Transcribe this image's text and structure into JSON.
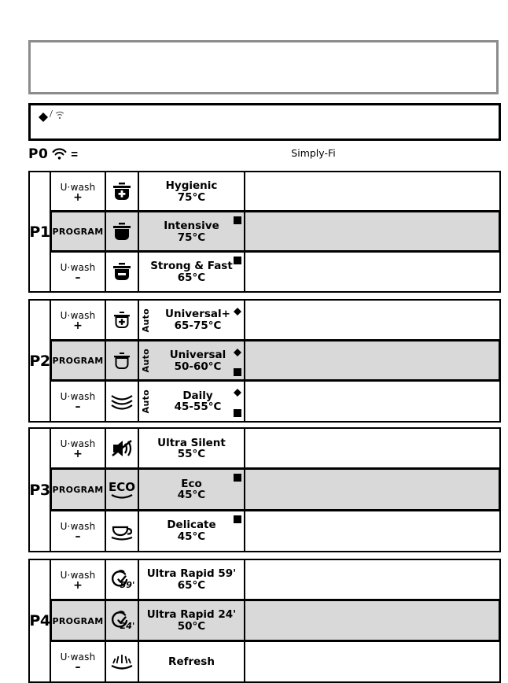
{
  "top_box": {
    "content": ""
  },
  "legend_box": {
    "diamond_icon": "diamond-marker",
    "separator": "/",
    "wifi_icon": "wifi-icon-faint"
  },
  "p0": {
    "label": "P0",
    "wifi_icon": "wifi-icon",
    "equals": "=",
    "brand": "Simply-Fi"
  },
  "wash_labels": {
    "plus_line1": "U·wash",
    "plus_line2": "+",
    "program": "PROGRAM",
    "minus_line1": "U·wash",
    "minus_line2": "–"
  },
  "auto_label": "Auto",
  "groups": [
    {
      "id": "P1",
      "label": "P1",
      "rows": [
        {
          "wash": "plus",
          "icon": "pot-plus-filled-icon",
          "auto": false,
          "title": "Hygienic",
          "temp": "75°C",
          "diamond": false,
          "square": false,
          "selected": false,
          "description": ""
        },
        {
          "wash": "program",
          "icon": "pot-filled-icon",
          "auto": false,
          "title": "Intensive",
          "temp": "75°C",
          "diamond": false,
          "square": true,
          "selected": true,
          "description": ""
        },
        {
          "wash": "minus",
          "icon": "pot-minus-filled-icon",
          "auto": false,
          "title": "Strong & Fast",
          "temp": "65°C",
          "diamond": false,
          "square": true,
          "square_top": true,
          "selected": false,
          "description": ""
        }
      ]
    },
    {
      "id": "P2",
      "label": "P2",
      "rows": [
        {
          "wash": "plus",
          "icon": "pot-plus-outline-icon",
          "auto": true,
          "title": "Universal+",
          "temp": "65-75°C",
          "diamond": true,
          "square": false,
          "selected": false,
          "description": ""
        },
        {
          "wash": "program",
          "icon": "pot-outline-icon",
          "auto": true,
          "title": "Universal",
          "temp": "50-60°C",
          "diamond": true,
          "square": true,
          "selected": true,
          "description": ""
        },
        {
          "wash": "minus",
          "icon": "stacked-plates-icon",
          "auto": true,
          "title": "Daily",
          "temp": "45-55°C",
          "diamond": true,
          "square": true,
          "selected": false,
          "description": ""
        }
      ]
    },
    {
      "id": "P3",
      "label": "P3",
      "rows": [
        {
          "wash": "plus",
          "icon": "silent-crossed-sound-icon",
          "auto": false,
          "title": "Ultra Silent",
          "temp": "55°C",
          "diamond": false,
          "square": false,
          "selected": false,
          "description": ""
        },
        {
          "wash": "program",
          "icon": "eco-icon",
          "auto": false,
          "title": "Eco",
          "temp": "45°C",
          "diamond": false,
          "square": true,
          "selected": true,
          "description": ""
        },
        {
          "wash": "minus",
          "icon": "cup-saucer-icon",
          "auto": false,
          "title": "Delicate",
          "temp": "45°C",
          "diamond": false,
          "square": true,
          "square_top": true,
          "selected": false,
          "description": ""
        }
      ]
    },
    {
      "id": "P4",
      "label": "P4",
      "rows": [
        {
          "wash": "plus",
          "icon": "stopwatch-59-icon",
          "auto": false,
          "title": "Ultra Rapid 59'",
          "temp": "65°C",
          "diamond": false,
          "square": false,
          "selected": false,
          "description": ""
        },
        {
          "wash": "program",
          "icon": "stopwatch-24-icon",
          "auto": false,
          "title": "Ultra Rapid 24'",
          "temp": "50°C",
          "diamond": false,
          "square": false,
          "selected": true,
          "description": ""
        },
        {
          "wash": "minus",
          "icon": "refresh-spray-icon",
          "auto": false,
          "title": "Refresh",
          "temp": "",
          "diamond": false,
          "square": false,
          "selected": false,
          "description": ""
        }
      ]
    }
  ],
  "colors": {
    "selected_row_bg": "#d9d9d9",
    "border": "#000000",
    "top_box_border": "#8c8c8c"
  }
}
